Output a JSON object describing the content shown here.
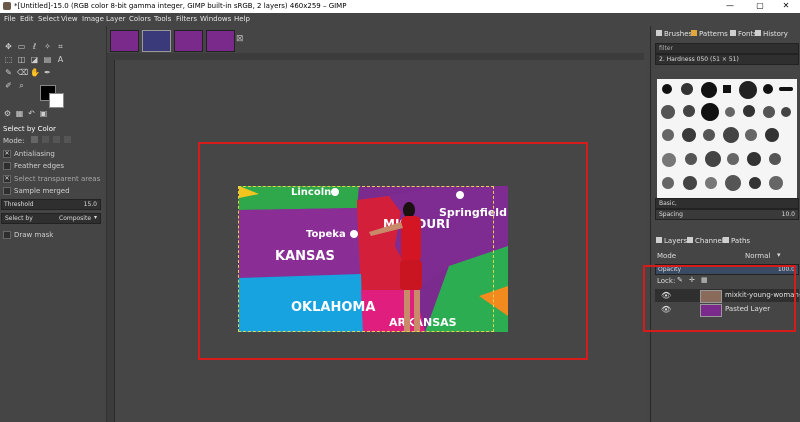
{
  "window": {
    "title": "*[Untitled]-15.0 (RGB color 8-bit gamma integer, GIMP built-in sRGB, 2 layers) 460x259 – GIMP",
    "minimize": "—",
    "maximize": "▢",
    "close": "✕"
  },
  "menu": [
    "File",
    "Edit",
    "Select",
    "View",
    "Image",
    "Layer",
    "Colors",
    "Tools",
    "Filters",
    "Windows",
    "Help"
  ],
  "tool_options": {
    "title": "Select by Color",
    "mode_label": "Mode:",
    "antialiasing": "Antialiasing",
    "feather_edges": "Feather edges",
    "select_transparent": "Select transparent areas",
    "sample_merged": "Sample merged",
    "threshold_label": "Threshold",
    "threshold_value": "15.0",
    "select_by_label": "Select by",
    "select_by_value": "Composite",
    "draw_mask": "Draw mask"
  },
  "image_tabs_close": "⊠",
  "canvas_image": {
    "labels": {
      "lincoln": "Lincoln",
      "springfield": "Springfield",
      "topeka": "Topeka",
      "kansas": "KANSAS",
      "missouri": "MISSOURI",
      "oklahoma": "OKLAHOMA",
      "arkansas": "ARKANSAS"
    }
  },
  "dock": {
    "tabs": {
      "brushes": "Brushes",
      "patterns": "Patterns",
      "fonts": "Fonts",
      "history": "History"
    },
    "filter_placeholder": "filter",
    "brush_name": "2. Hardness 050 (51 × 51)",
    "preset": "Basic,",
    "spacing_label": "Spacing",
    "spacing_value": "10.0",
    "layer_tabs": {
      "layers": "Layers",
      "channels": "Channels",
      "paths": "Paths"
    },
    "mode_label": "Mode",
    "mode_value": "Normal",
    "opacity_label": "Opacity",
    "opacity_value": "100.0",
    "lock_label": "Lock:",
    "layers": [
      {
        "name": "mixkit-young-woman-givin"
      },
      {
        "name": "Pasted Layer"
      }
    ]
  },
  "colors": {
    "annotation": "#d61b1b",
    "boundary": "#e1d54a"
  }
}
